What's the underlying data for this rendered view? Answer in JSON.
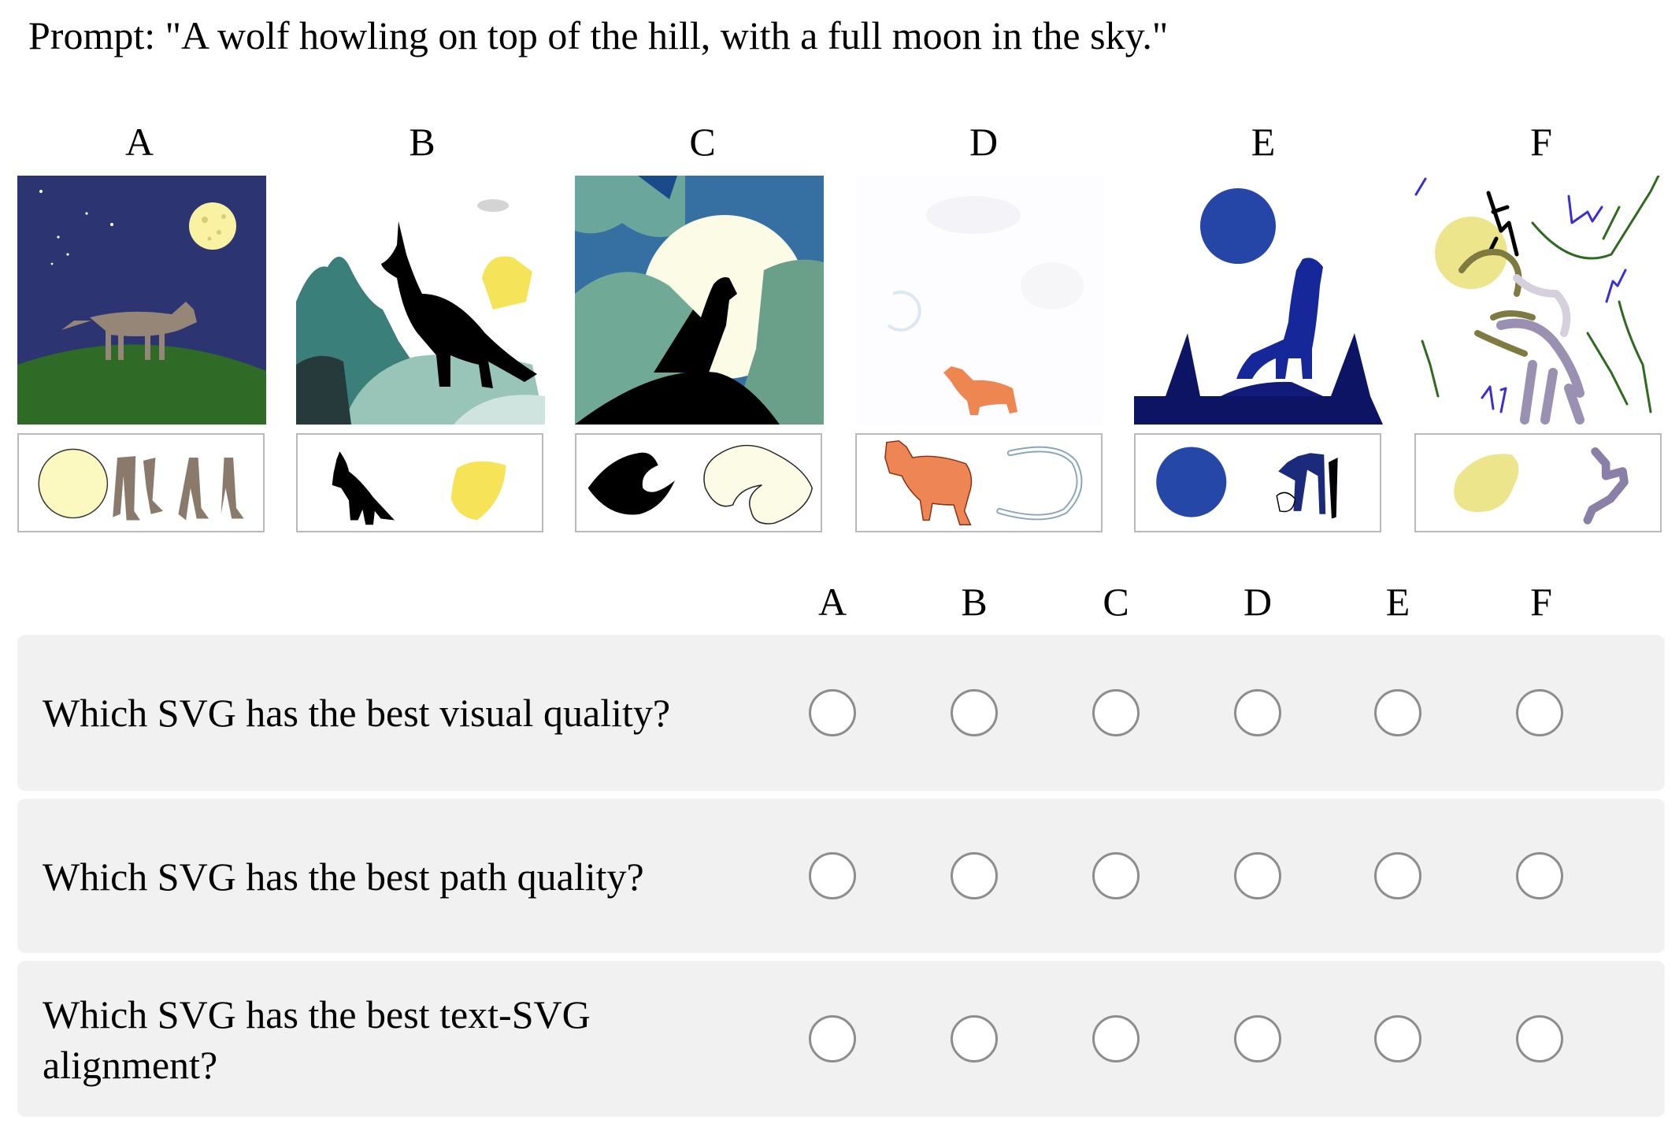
{
  "prompt": "Prompt: \"A wolf howling on top of the hill, with a full moon in the sky.\"",
  "candidates": [
    "A",
    "B",
    "C",
    "D",
    "E",
    "F"
  ],
  "option_headers": [
    "A",
    "B",
    "C",
    "D",
    "E",
    "F"
  ],
  "questions": [
    {
      "text": "Which SVG has the best visual quality?",
      "selected": null
    },
    {
      "text": "Which SVG has the best path quality?",
      "selected": null
    },
    {
      "text": "Which SVG has the best text-SVG alignment?",
      "selected": null
    }
  ],
  "colors": {
    "row_background": "#f1f1f1",
    "radio_border": "#8d8d8d",
    "parts_border": "#b9b9b9"
  }
}
